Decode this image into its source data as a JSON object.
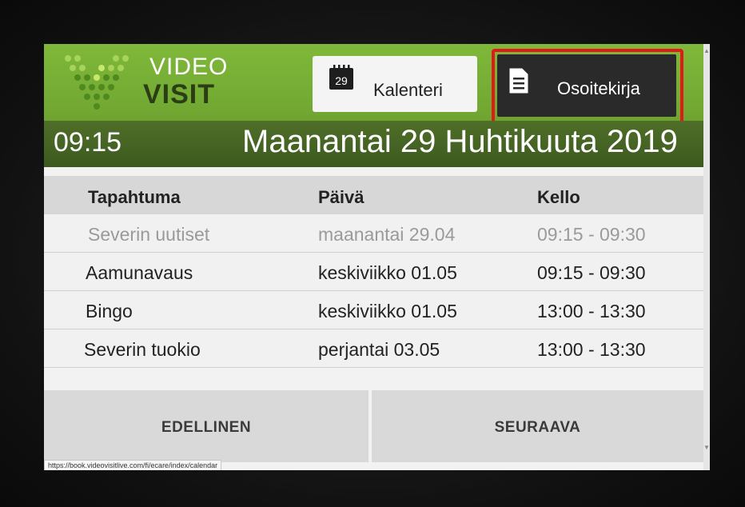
{
  "logo": {
    "line1": "VIDEO",
    "line2": "VISIT"
  },
  "header": {
    "calendar_button": {
      "label": "Kalenteri",
      "icon": "calendar-icon",
      "icon_text": "29"
    },
    "address_button": {
      "label": "Osoitekirja",
      "icon": "document-icon"
    },
    "time": "09:15",
    "date": "Maanantai 29 Huhtikuuta 2019"
  },
  "table": {
    "columns": [
      "Tapahtuma",
      "Päivä",
      "Kello"
    ],
    "rows": [
      {
        "event": "Severin uutiset",
        "day": "maanantai 29.04",
        "time": "09:15 - 09:30"
      },
      {
        "event": "Aamunavaus",
        "day": "keskiviikko 01.05",
        "time": "09:15 - 09:30"
      },
      {
        "event": "Bingo",
        "day": "keskiviikko 01.05",
        "time": "13:00 - 13:30"
      },
      {
        "event": "Severin tuokio",
        "day": "perjantai 03.05",
        "time": "13:00 - 13:30"
      }
    ]
  },
  "footer": {
    "prev_label": "EDELLINEN",
    "next_label": "SEURAAVA"
  },
  "status_url": "https://book.videovisitlive.com/fi/ecare/index/calendar",
  "colors": {
    "brand_green": "#72a832",
    "date_bar": "#4a6825",
    "highlight": "#e31919"
  }
}
